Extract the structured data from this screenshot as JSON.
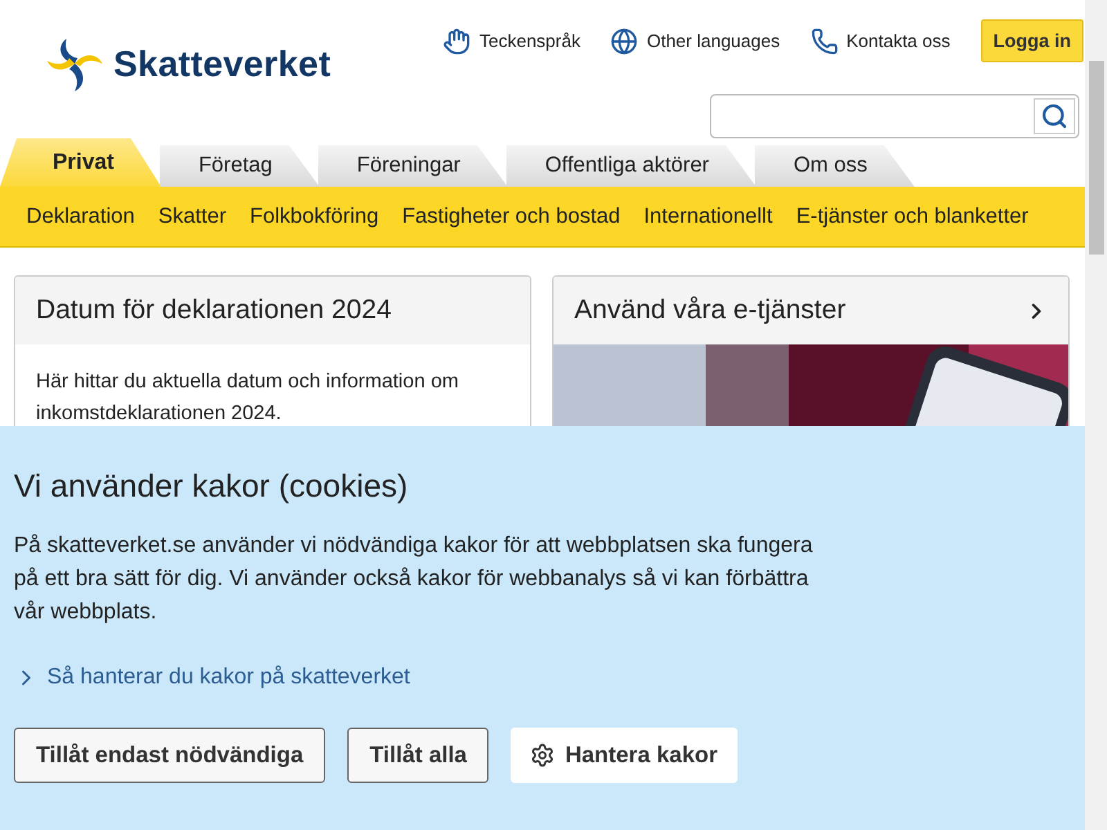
{
  "header": {
    "logo": "Skatteverket",
    "links": [
      {
        "kind": "sign",
        "label": "Teckenspråk"
      },
      {
        "kind": "globe",
        "label": "Other languages"
      },
      {
        "kind": "phone",
        "label": "Kontakta oss"
      }
    ],
    "login": "Logga in"
  },
  "tabs": [
    {
      "label": "Privat",
      "selected": true
    },
    {
      "label": "Företag",
      "selected": false
    },
    {
      "label": "Föreningar",
      "selected": false
    },
    {
      "label": "Offentliga aktörer",
      "selected": false
    },
    {
      "label": "Om oss",
      "selected": false
    }
  ],
  "subnav": [
    "Deklaration",
    "Skatter",
    "Folkbokföring",
    "Fastigheter och bostad",
    "Internationellt",
    "E-tjänster och blanketter"
  ],
  "cards": [
    {
      "kind": "text",
      "title": "Datum för deklarationen 2024",
      "text": "Här hittar du aktuella datum och information om inkomstdeklarationen 2024."
    },
    {
      "kind": "picture",
      "title": "Använd våra e-tjänster"
    }
  ],
  "cookie_banner": {
    "title": "Vi använder kakor (cookies)",
    "text": "På skatteverket.se använder vi nödvändiga kakor för att webbplatsen ska fungera på ett bra sätt för dig. Vi använder också kakor för webbanalys så vi kan förbättra vår webbplats.",
    "link": "Så hanterar du kakor på skatteverket",
    "buttons": [
      {
        "kind": "outline",
        "label": "Tillåt endast nödvändiga"
      },
      {
        "kind": "outline",
        "label": "Tillåt alla"
      },
      {
        "kind": "settings",
        "label": "Hantera kakor"
      }
    ]
  }
}
